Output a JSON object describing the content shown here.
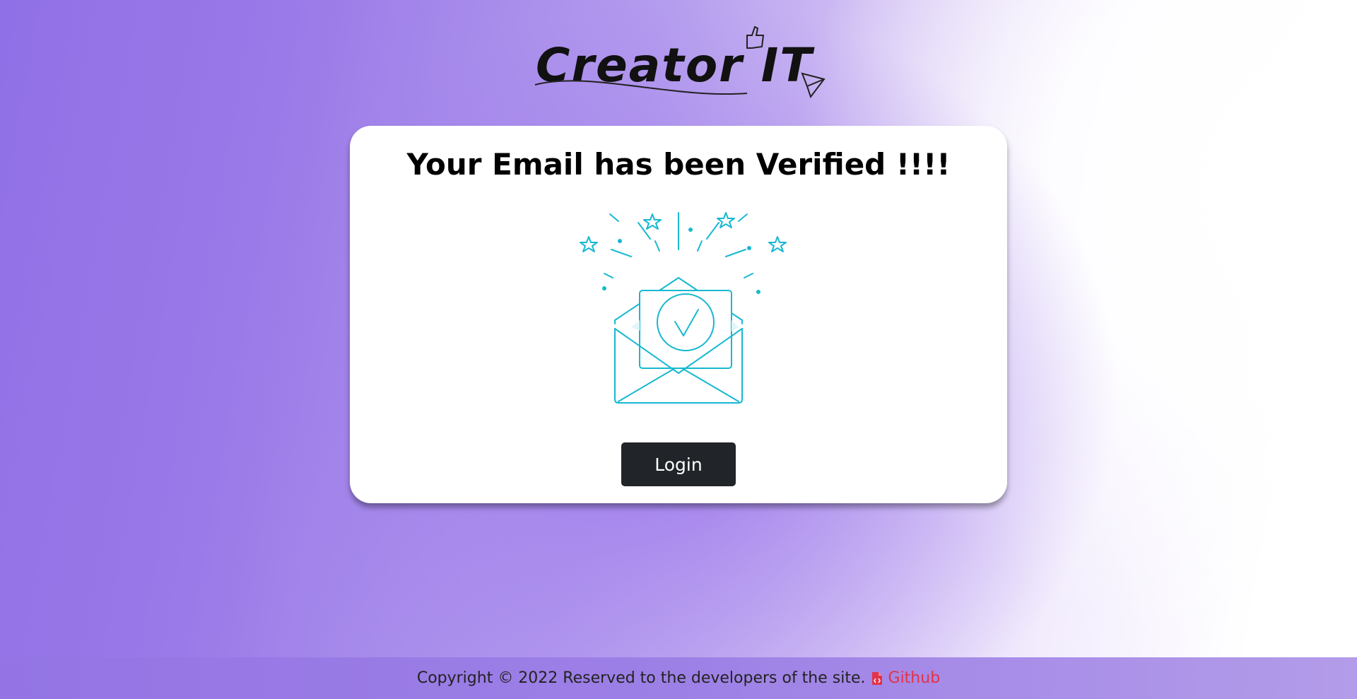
{
  "brand": {
    "logo_text": "Creator IT"
  },
  "card": {
    "title": "Your Email has been Verified !!!!",
    "illustration_icon": "envelope-check-icon",
    "login_label": "Login"
  },
  "footer": {
    "copyright": "Copyright © 2022 Reserved to the developers of the site.",
    "github_label": "Github",
    "github_icon": "file-code-icon"
  },
  "colors": {
    "accent": "#17b8d1",
    "button_bg": "#212529",
    "link": "#e4324a"
  }
}
